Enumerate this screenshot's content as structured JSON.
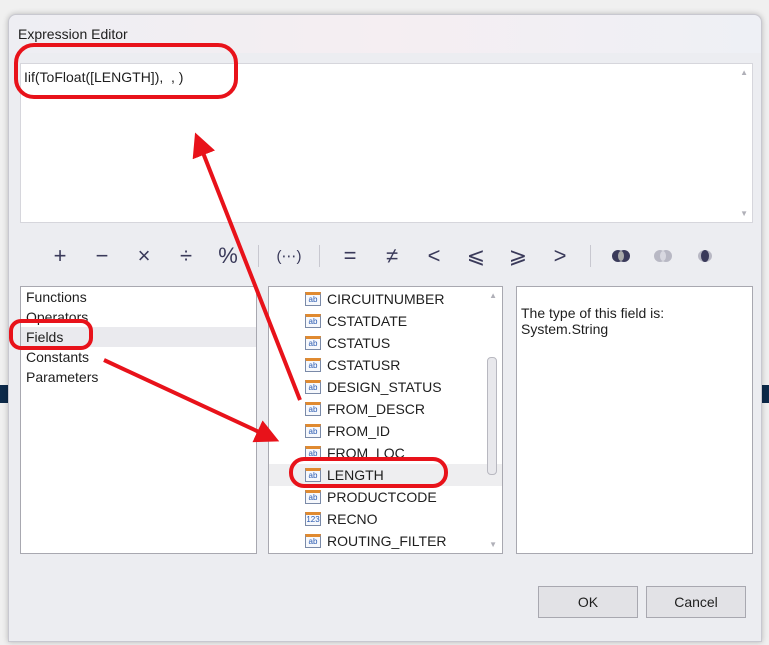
{
  "dialog": {
    "title": "Expression Editor"
  },
  "editor": {
    "expression": "Iif(ToFloat([LENGTH]),  , )"
  },
  "operators": [
    "+",
    "−",
    "×",
    "÷",
    "%",
    "(⋯)",
    "=",
    "≠",
    "<",
    "⩽",
    "⩾",
    ">"
  ],
  "categories": [
    {
      "label": "Functions"
    },
    {
      "label": "Operators"
    },
    {
      "label": "Fields",
      "selected": true
    },
    {
      "label": "Constants"
    },
    {
      "label": "Parameters"
    }
  ],
  "fields": [
    {
      "name": "CIRCUITNUMBER",
      "type": "ab"
    },
    {
      "name": "CSTATDATE",
      "type": "ab"
    },
    {
      "name": "CSTATUS",
      "type": "ab"
    },
    {
      "name": "CSTATUSR",
      "type": "ab"
    },
    {
      "name": "DESIGN_STATUS",
      "type": "ab"
    },
    {
      "name": "FROM_DESCR",
      "type": "ab"
    },
    {
      "name": "FROM_ID",
      "type": "ab"
    },
    {
      "name": "FROM_LOC",
      "type": "ab"
    },
    {
      "name": "LENGTH",
      "type": "ab",
      "selected": true
    },
    {
      "name": "PRODUCTCODE",
      "type": "ab"
    },
    {
      "name": "RECNO",
      "type": "123"
    },
    {
      "name": "ROUTING_FILTER",
      "type": "ab"
    }
  ],
  "description": "The type of this field is:\nSystem.String",
  "buttons": {
    "ok": "OK",
    "cancel": "Cancel"
  },
  "annotation_color": "#e8121a"
}
